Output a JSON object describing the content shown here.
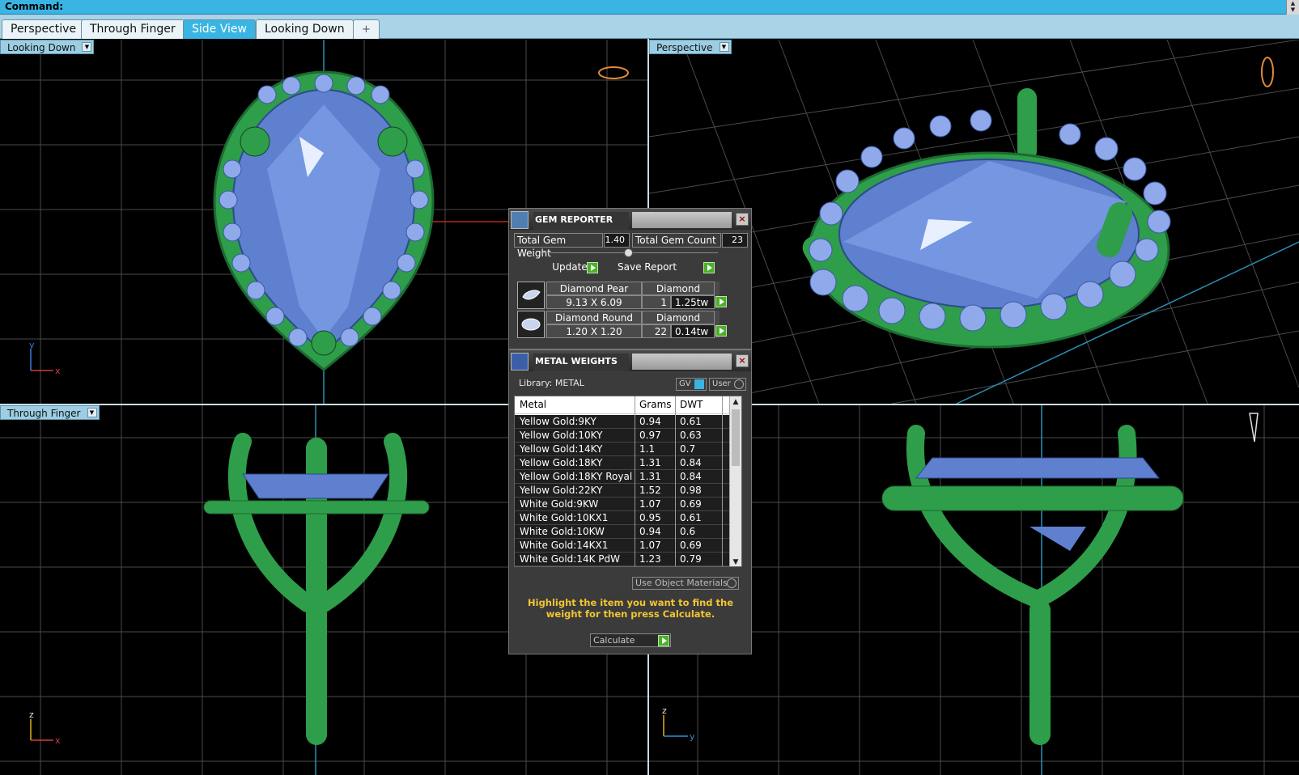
{
  "command_bar": {
    "label": "Command:"
  },
  "tabs": [
    {
      "label": "Perspective",
      "active": false
    },
    {
      "label": "Through Finger",
      "active": false
    },
    {
      "label": "Side View",
      "active": true
    },
    {
      "label": "Looking Down",
      "active": false
    },
    {
      "label": "+",
      "active": false
    }
  ],
  "viewports": {
    "top_left": {
      "label": "Looking Down",
      "axis_v": "y",
      "axis_h": "x"
    },
    "top_right": {
      "label": "Perspective"
    },
    "bottom_left": {
      "label": "Through Finger",
      "axis_v": "z",
      "axis_h": "x"
    },
    "bottom_right": {
      "label": "",
      "axis_v": "z",
      "axis_h": "y"
    }
  },
  "gem_reporter": {
    "title": "GEM REPORTER",
    "total_weight_label": "Total Gem Weight",
    "total_weight_value": "1.40",
    "total_count_label": "Total Gem Count",
    "total_count_value": "23",
    "update_label": "Update",
    "save_report_label": "Save Report",
    "gems": [
      {
        "name": "Diamond Pear",
        "material": "Diamond",
        "size": "9.13 X 6.09",
        "count": "1",
        "weight": "1.25tw"
      },
      {
        "name": "Diamond Round",
        "material": "Diamond",
        "size": "1.20 X 1.20",
        "count": "22",
        "weight": "0.14tw"
      }
    ]
  },
  "metal_weights": {
    "title": "METAL WEIGHTS",
    "library_label": "Library: METAL",
    "gv_label": "GV",
    "user_label": "User",
    "columns": {
      "metal": "Metal",
      "grams": "Grams",
      "dwt": "DWT"
    },
    "rows": [
      {
        "metal": "Yellow Gold:9KY",
        "grams": "0.94",
        "dwt": "0.61"
      },
      {
        "metal": "Yellow Gold:10KY",
        "grams": "0.97",
        "dwt": "0.63"
      },
      {
        "metal": "Yellow Gold:14KY",
        "grams": "1.1",
        "dwt": "0.7"
      },
      {
        "metal": "Yellow Gold:18KY",
        "grams": "1.31",
        "dwt": "0.84"
      },
      {
        "metal": "Yellow Gold:18KY Royal",
        "grams": "1.31",
        "dwt": "0.84"
      },
      {
        "metal": "Yellow Gold:22KY",
        "grams": "1.52",
        "dwt": "0.98"
      },
      {
        "metal": "White Gold:9KW",
        "grams": "1.07",
        "dwt": "0.69"
      },
      {
        "metal": "White Gold:10KX1",
        "grams": "0.95",
        "dwt": "0.61"
      },
      {
        "metal": "White Gold:10KW",
        "grams": "0.94",
        "dwt": "0.6"
      },
      {
        "metal": "White Gold:14KX1",
        "grams": "1.07",
        "dwt": "0.69"
      },
      {
        "metal": "White Gold:14K PdW",
        "grams": "1.23",
        "dwt": "0.79"
      }
    ],
    "use_object_materials_label": "Use Object Materials",
    "hint": "Highlight the item you want to find the weight for then press Calculate.",
    "calculate_label": "Calculate"
  },
  "colors": {
    "accent": "#3ab5e3",
    "metal_green": "#2e9e4a",
    "gem_blue": "#6f8fd6",
    "grid": "#4a4a4a",
    "hint_yellow": "#f2c531"
  }
}
